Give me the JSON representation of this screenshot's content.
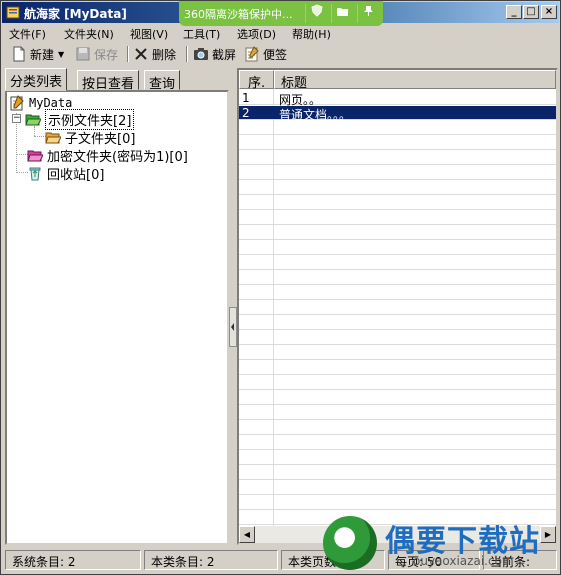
{
  "window": {
    "title": "航海家 [MyData]"
  },
  "sandbox": {
    "text": "360隔离沙箱保护中..."
  },
  "menu": [
    {
      "label": "文件(F)"
    },
    {
      "label": "文件夹(N)"
    },
    {
      "label": "视图(V)"
    },
    {
      "label": "工具(T)"
    },
    {
      "label": "选项(D)"
    },
    {
      "label": "帮助(H)"
    }
  ],
  "toolbar": {
    "new": "新建",
    "save": "保存",
    "delete": "删除",
    "screenshot": "截屏",
    "note": "便签"
  },
  "tabs": [
    {
      "label": "分类列表"
    },
    {
      "label": "按日查看"
    },
    {
      "label": "查询"
    }
  ],
  "tree": {
    "root": "MyData",
    "items": [
      {
        "label": "示例文件夹[2]"
      },
      {
        "label": "子文件夹[0]"
      },
      {
        "label": "加密文件夹(密码为1)[0]"
      },
      {
        "label": "回收站[0]"
      }
    ]
  },
  "list": {
    "headers": {
      "num": "序.",
      "title": "标题"
    },
    "rows": [
      {
        "num": "1",
        "title": "网页。。"
      },
      {
        "num": "2",
        "title": "普通文档。。。"
      }
    ]
  },
  "status": {
    "system_count": "系统条目: 2",
    "category_count": "本类条目: 2",
    "category_pages": "本类页数:",
    "per_page": "每页: 50",
    "current": "当前条:"
  },
  "watermark": {
    "brand": "偶要下载站",
    "url": "ouyaoxiazai.com"
  },
  "colors": {
    "selection": "#0a246a",
    "sandbox_bar": "#7bc142",
    "brand": "#1f6dbf"
  }
}
